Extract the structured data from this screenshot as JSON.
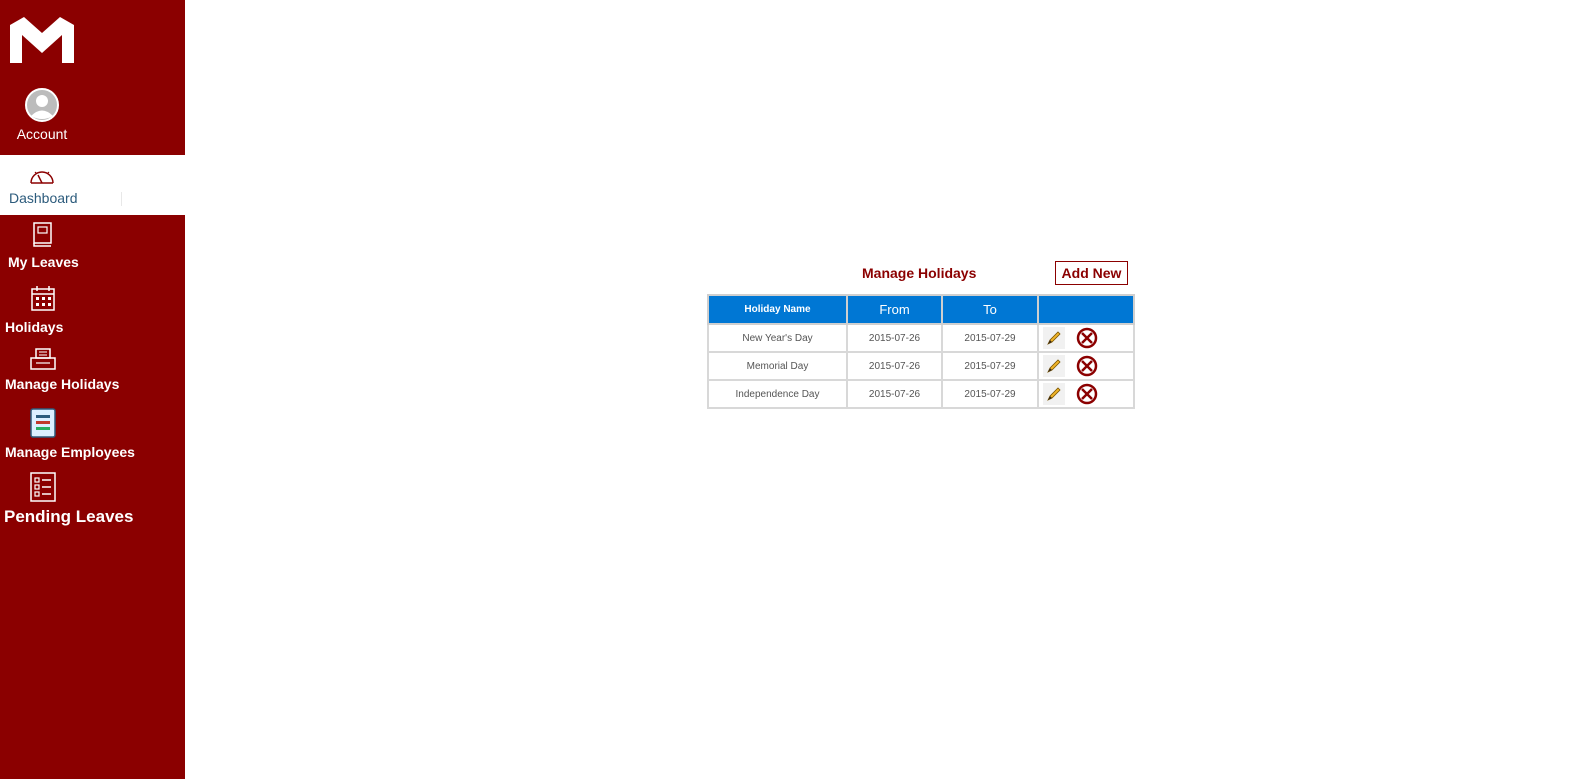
{
  "sidebar": {
    "account_label": "Account",
    "dashboard_label": "Dashboard",
    "items": [
      {
        "label": "My Leaves",
        "icon": "book-icon"
      },
      {
        "label": "Holidays",
        "icon": "calendar-icon"
      },
      {
        "label": "Manage Holidays",
        "icon": "printer-icon"
      },
      {
        "label": "Manage Employees",
        "icon": "list-card-icon"
      },
      {
        "label": "Pending Leaves",
        "icon": "checklist-icon"
      }
    ]
  },
  "main": {
    "title": "Manage Holidays",
    "add_new_label": "Add New",
    "table": {
      "headers": [
        "Holiday Name",
        "From",
        "To",
        ""
      ],
      "rows": [
        {
          "name": "New Year's Day",
          "from": "2015-07-26",
          "to": "2015-07-29"
        },
        {
          "name": "Memorial Day",
          "from": "2015-07-26",
          "to": "2015-07-29"
        },
        {
          "name": "Independence Day",
          "from": "2015-07-26",
          "to": "2015-07-29"
        }
      ]
    }
  },
  "colors": {
    "sidebar": "#8b0000",
    "accent": "#8b0000",
    "table_header": "#0077d4",
    "dashboard_text": "#2c5b7c"
  }
}
